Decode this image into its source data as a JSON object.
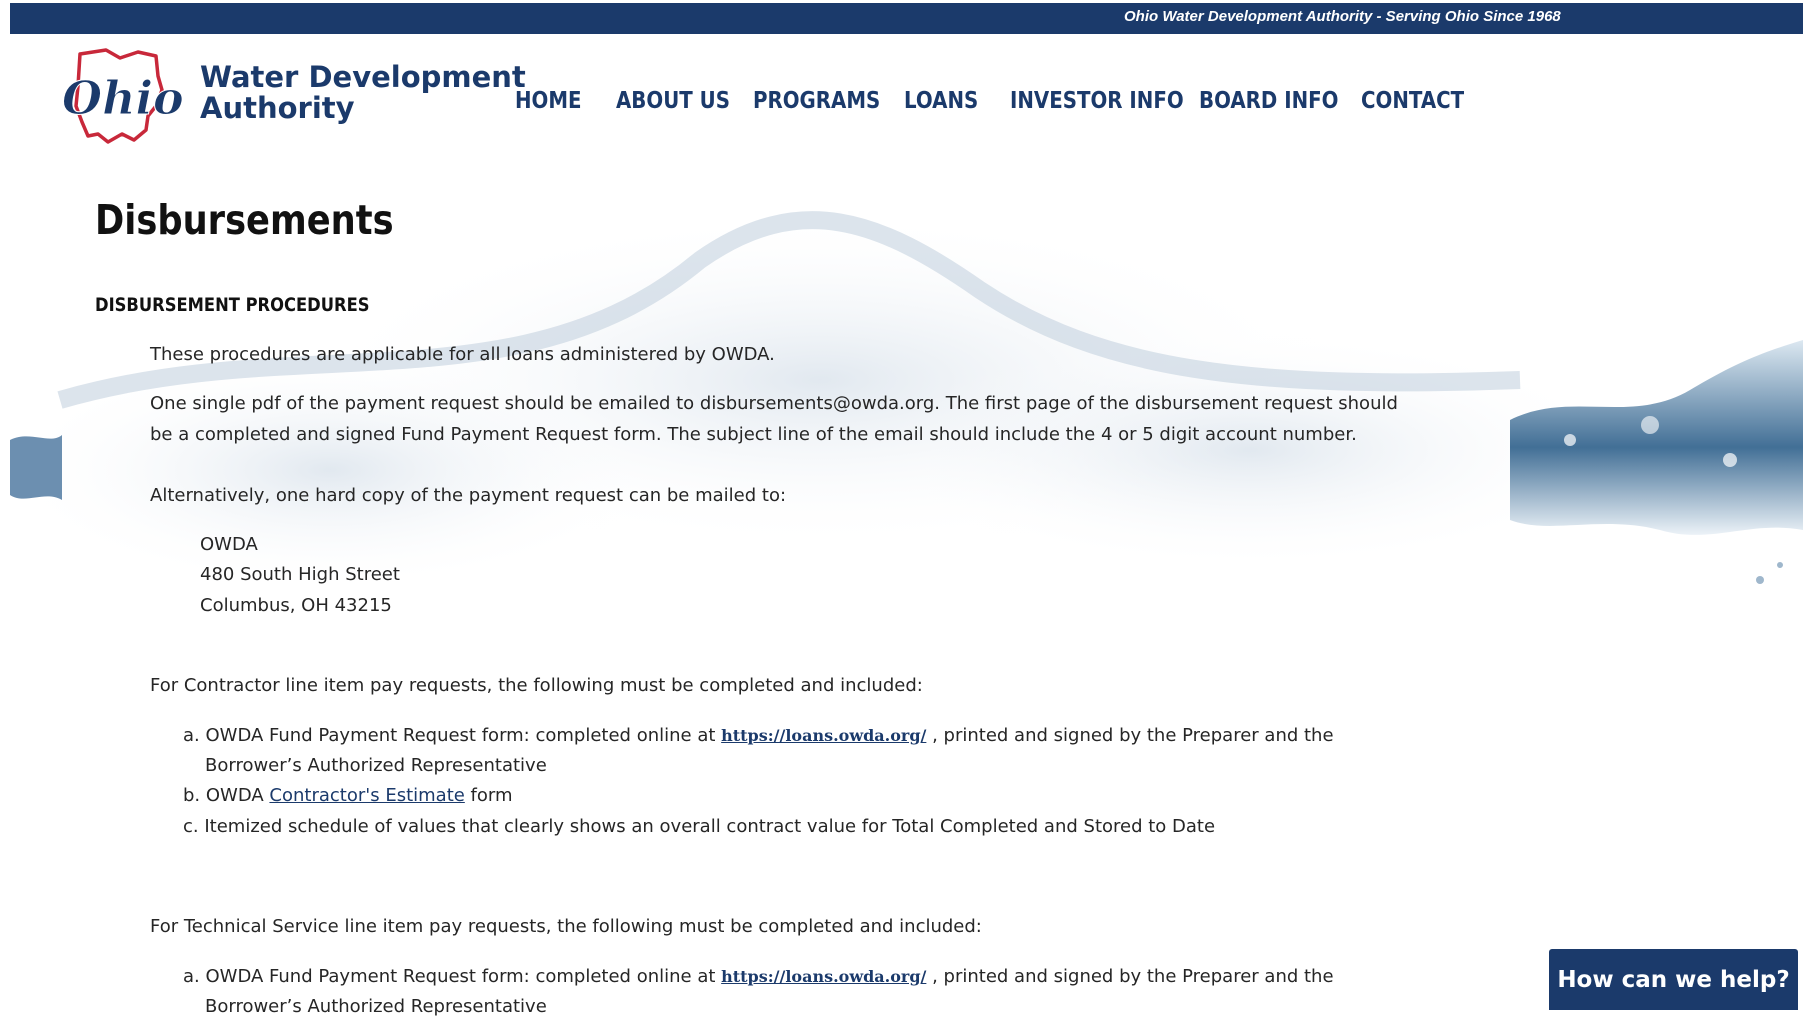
{
  "top_bar": {
    "tagline": "Ohio Water Development Authority - Serving Ohio Since 1968"
  },
  "logo": {
    "script_text": "Ohio",
    "line1": "Water Development",
    "line2": "Authority"
  },
  "nav": {
    "items": [
      {
        "label": "HOME"
      },
      {
        "label": "ABOUT US"
      },
      {
        "label": "PROGRAMS"
      },
      {
        "label": "LOANS"
      },
      {
        "label": "INVESTOR INFO"
      },
      {
        "label": "BOARD INFO"
      },
      {
        "label": "CONTACT"
      }
    ]
  },
  "page": {
    "title": "Disbursements",
    "section_heading": "DISBURSEMENT PROCEDURES",
    "intro": "These procedures are applicable for all loans administered by OWDA.",
    "email_para_line1": "One single pdf of the payment request should be emailed to disbursements@owda.org. The first page of the disbursement request should",
    "email_para_line2": "be a completed and signed Fund Payment Request form. The subject line of the email should include the 4 or 5 digit account number.",
    "alt_para": "Alternatively, one hard copy of the payment request can be mailed to:",
    "address": {
      "line1": "OWDA",
      "line2": "480 South High Street",
      "line3": "Columbus, OH 43215"
    },
    "contractor": {
      "intro": "For Contractor line item pay requests, the following must be completed and included:",
      "item_a_prefix": "a. OWDA Fund Payment Request form: completed online at ",
      "item_a_link": "https://loans.owda.org/",
      "item_a_suffix": " , printed and signed by the Preparer and the",
      "item_a_line2": "Borrower’s Authorized Representative",
      "item_b_prefix": "b. OWDA ",
      "item_b_link": "Contractor's Estimate",
      "item_b_suffix": " form",
      "item_c": "c. Itemized schedule of values that clearly shows an overall contract value for Total Completed and Stored to Date"
    },
    "technical": {
      "intro": "For Technical Service line item pay requests, the following must be completed and included:",
      "item_a_prefix": "a. OWDA Fund Payment Request form: completed online at ",
      "item_a_link": "https://loans.owda.org/",
      "item_a_suffix": " , printed and signed by the Preparer and the",
      "item_a_line2": "Borrower’s Authorized Representative"
    }
  },
  "help_button": {
    "label": "How can we help?"
  },
  "colors": {
    "brand_navy": "#1b3a6b",
    "ohio_red": "#c8283a"
  }
}
